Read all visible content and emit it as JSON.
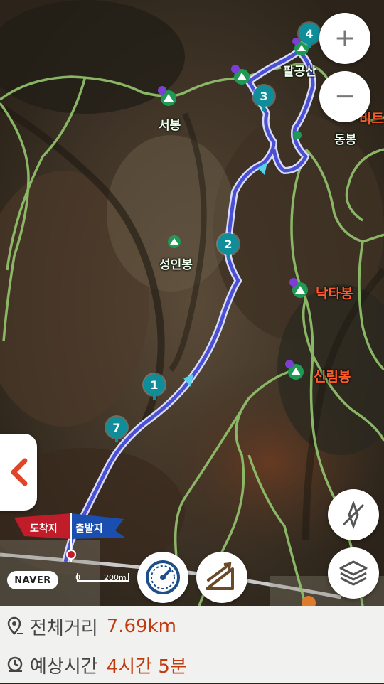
{
  "map": {
    "peaks": [
      {
        "name": "서봉"
      },
      {
        "name": "성인봉"
      },
      {
        "name": "팔공산"
      },
      {
        "name": "동봉"
      },
      {
        "name": "낙타봉"
      },
      {
        "name": "신림봉"
      },
      {
        "name": "비트"
      }
    ],
    "waypoints": [
      "1",
      "2",
      "3",
      "4",
      "7"
    ],
    "start_label": "출발지",
    "end_label": "도착지",
    "logo": "NAVER",
    "scale": {
      "zero": "0",
      "distance": "200m"
    }
  },
  "controls": {
    "zoom_in": "+",
    "zoom_out": "−"
  },
  "summary": {
    "distance_label": "전체거리",
    "distance_value": "7.69km",
    "time_label": "예상시간",
    "time_value": "4시간 5분"
  },
  "colors": {
    "route": "#4a4fd6",
    "trail": "#8fbf6a",
    "waypoint": "#0f8e9a",
    "accent": "#c23b0f",
    "start_flag": "#1a4fb0",
    "end_flag": "#c01c2a"
  }
}
